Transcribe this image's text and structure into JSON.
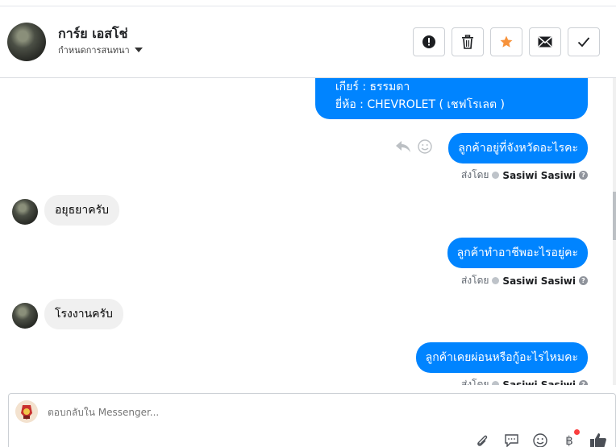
{
  "header": {
    "name": "การ์ย เอสโช่",
    "assign_label": "กำหนดการสนทนา",
    "actions": [
      "mark-spam",
      "delete",
      "star",
      "mark-unread",
      "done"
    ]
  },
  "messages": {
    "m1_line1": "เกียร์ : ธรรมดา",
    "m1_line2": "ยี่ห้อ : CHEVROLET ( เชฟโรเลต )",
    "m2": "ลูกค้าอยู่ที่จังหวัดอะไรคะ",
    "m3": "อยุธยาครับ",
    "m4": "ลูกค้าทำอาชีพอะไรอยู่คะ",
    "m5": "โรงงานครับ",
    "m6": "ลูกค้าเคยผ่อนหรือกู้อะไรไหมคะ"
  },
  "sent_by": {
    "label": "ส่งโดย",
    "agent": "Sasiwi Sasiwi",
    "help": "?"
  },
  "composer": {
    "placeholder": "ตอบกลับใน Messenger...",
    "currency_symbol": "฿"
  },
  "colors": {
    "accent": "#0084ff",
    "incoming": "#f0f0f0",
    "star": "#f7923a"
  }
}
